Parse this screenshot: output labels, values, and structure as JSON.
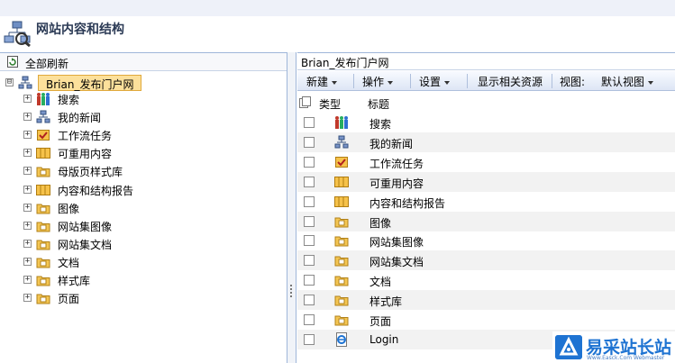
{
  "header": {
    "title": "网站内容和结构"
  },
  "left": {
    "refresh_label": "全部刷新",
    "root": {
      "label": "Brian_发布门户网",
      "expander": "⊟"
    },
    "items": [
      {
        "label": "搜索",
        "icon": "people-icon",
        "expander": "+"
      },
      {
        "label": "我的新闻",
        "icon": "site-icon",
        "expander": "+"
      },
      {
        "label": "工作流任务",
        "icon": "task-icon",
        "expander": "+"
      },
      {
        "label": "可重用内容",
        "icon": "list-icon",
        "expander": "+"
      },
      {
        "label": "母版页样式库",
        "icon": "folder-icon",
        "expander": "+"
      },
      {
        "label": "内容和结构报告",
        "icon": "list-icon",
        "expander": "+"
      },
      {
        "label": "图像",
        "icon": "folder-icon",
        "expander": "+"
      },
      {
        "label": "网站集图像",
        "icon": "folder-icon",
        "expander": "+"
      },
      {
        "label": "网站集文档",
        "icon": "folder-icon",
        "expander": "+"
      },
      {
        "label": "文档",
        "icon": "folder-icon",
        "expander": "+"
      },
      {
        "label": "样式库",
        "icon": "folder-icon",
        "expander": "+"
      },
      {
        "label": "页面",
        "icon": "folder-icon",
        "expander": "+"
      }
    ]
  },
  "right": {
    "breadcrumb": "Brian_发布门户网",
    "toolbar": {
      "new_label": "新建",
      "actions_label": "操作",
      "settings_label": "设置",
      "related_label": "显示相关资源",
      "view_caption": "视图:",
      "view_value": "默认视图"
    },
    "columns": {
      "type": "类型",
      "title": "标题"
    },
    "rows": [
      {
        "title": "搜索",
        "icon": "people-icon"
      },
      {
        "title": "我的新闻",
        "icon": "site-icon"
      },
      {
        "title": "工作流任务",
        "icon": "task-icon"
      },
      {
        "title": "可重用内容",
        "icon": "list-icon"
      },
      {
        "title": "内容和结构报告",
        "icon": "list-icon"
      },
      {
        "title": "图像",
        "icon": "folder-icon"
      },
      {
        "title": "网站集图像",
        "icon": "folder-icon"
      },
      {
        "title": "网站集文档",
        "icon": "folder-icon"
      },
      {
        "title": "文档",
        "icon": "folder-icon"
      },
      {
        "title": "样式库",
        "icon": "folder-icon"
      },
      {
        "title": "页面",
        "icon": "folder-icon"
      },
      {
        "title": "Login",
        "icon": "ie-page-icon"
      }
    ]
  },
  "watermark": {
    "text": "易采站长站",
    "sub": "Www.Easck.Com Webmaster"
  },
  "colors": {
    "selection_bg": "#fce09b",
    "pane_border": "#9fb6d9",
    "watermark_blue": "#1e73d2"
  }
}
